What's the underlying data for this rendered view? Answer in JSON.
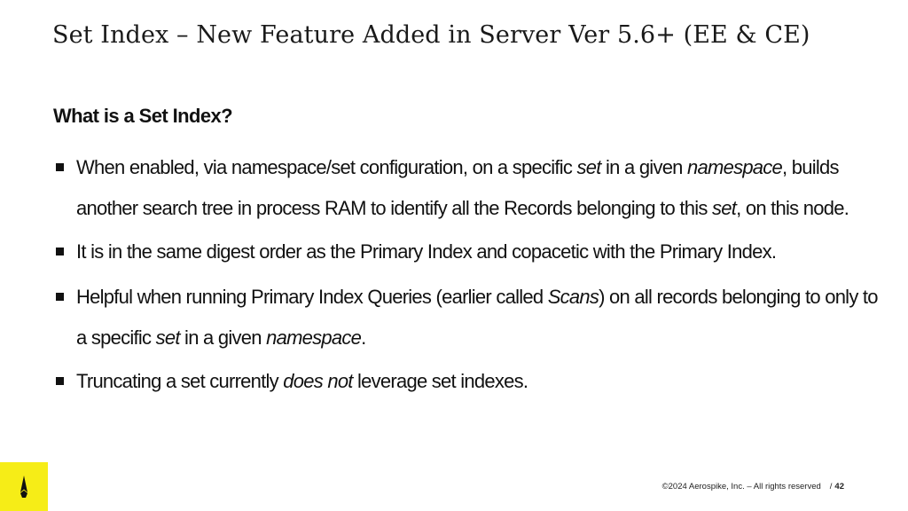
{
  "slide": {
    "title": "Set Index – New Feature Added in Server Ver 5.6+  (EE & CE)",
    "heading": "What is a Set Index?",
    "bullets": [
      [
        {
          "t": "When enabled, via namespace/set configuration, on a specific ",
          "i": false
        },
        {
          "t": "set",
          "i": true
        },
        {
          "t": " in a given ",
          "i": false
        },
        {
          "t": "namespace",
          "i": true
        },
        {
          "t": ", builds another search tree in process RAM to identify all the Records belonging to this ",
          "i": false
        },
        {
          "t": "set",
          "i": true
        },
        {
          "t": ", on this node.",
          "i": false
        }
      ],
      [
        {
          "t": "It is in the same digest order as the Primary Index and copacetic with the Primary Index.",
          "i": false
        }
      ],
      [
        {
          "t": "Helpful when running Primary Index Queries (earlier called ",
          "i": false
        },
        {
          "t": "Scans",
          "i": true
        },
        {
          "t": ") on all records belonging to only to a specific ",
          "i": false
        },
        {
          "t": "set",
          "i": true
        },
        {
          "t": " in a given ",
          "i": false
        },
        {
          "t": "namespace",
          "i": true
        },
        {
          "t": ".",
          "i": false
        }
      ],
      [
        {
          "t": "Truncating a set currently ",
          "i": false
        },
        {
          "t": "does not",
          "i": true
        },
        {
          "t": " leverage set indexes.",
          "i": false
        }
      ]
    ]
  },
  "footer": {
    "copyright": "©2024 Aerospike, Inc. – All rights reserved",
    "page_separator": "/",
    "page_number": "42"
  },
  "brand": {
    "logo_icon": "aerospike-rocket-icon",
    "accent_color": "#f6ed17"
  }
}
